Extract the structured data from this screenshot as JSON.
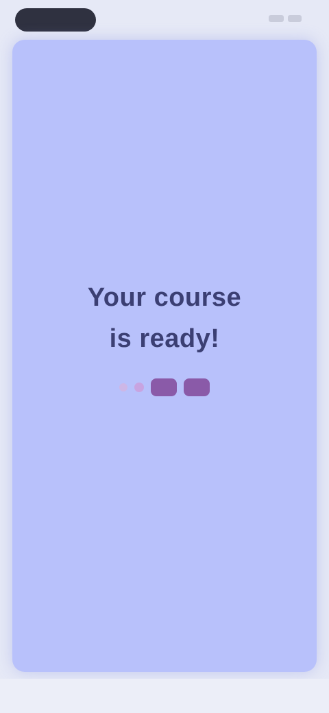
{
  "status_bar": {
    "icons": [
      "signal-icon",
      "battery-icon"
    ]
  },
  "card": {
    "title_line1": "Your course",
    "title_line2": "is ready!",
    "progress_dots": 4,
    "colors": {
      "background": "#b8c1fb",
      "text": "#3b3f73",
      "accent": "#8a5aa8"
    }
  }
}
